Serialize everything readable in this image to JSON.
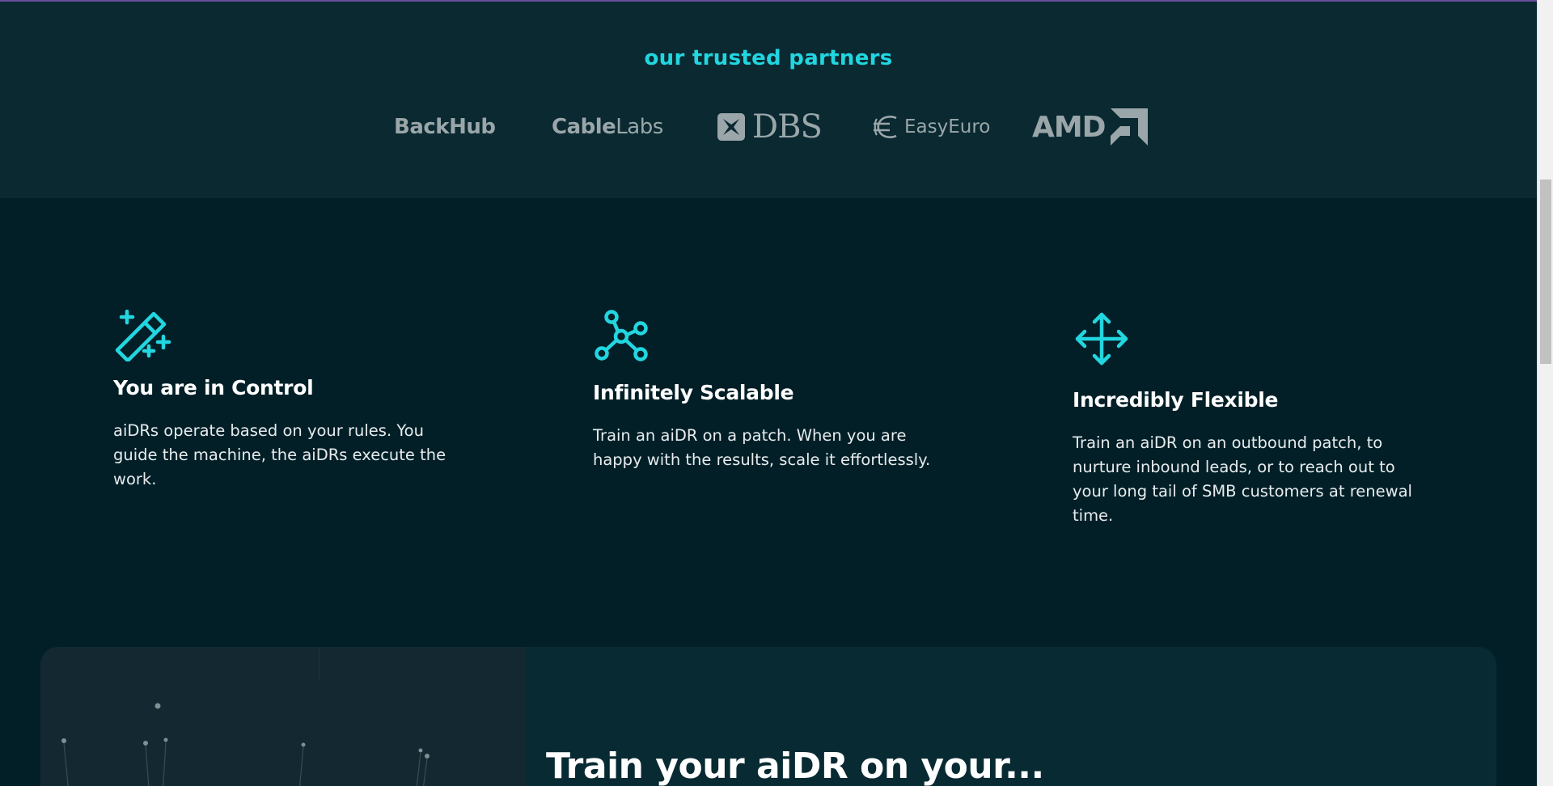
{
  "partners": {
    "title": "our trusted partners",
    "logos": [
      {
        "name": "BackHub",
        "text": "BackHub"
      },
      {
        "name": "CableLabs",
        "text_bold": "Cable",
        "text_light": "Labs"
      },
      {
        "name": "DBS",
        "text": "DBS"
      },
      {
        "name": "EasyEuro",
        "text": "EasyEuro"
      },
      {
        "name": "AMD",
        "text": "AMD"
      }
    ],
    "logo_color": "#9aa6a9"
  },
  "features": [
    {
      "icon": "magic-wand-icon",
      "title": "You are in Control",
      "description": "aiDRs operate based on your rules. You guide the machine, the aiDRs execute the work."
    },
    {
      "icon": "network-nodes-icon",
      "title": "Infinitely Scalable",
      "description": "Train an aiDR on a patch. When you are happy with the results, scale it effortlessly."
    },
    {
      "icon": "move-arrows-icon",
      "title": "Incredibly Flexible",
      "description": "Train an aiDR on an outbound patch, to nurture inbound leads, or to reach out to your long tail of SMB customers at renewal time."
    }
  ],
  "train_section": {
    "heading": "Train your aiDR on your..."
  },
  "colors": {
    "accent": "#22d6e0",
    "background": "#021f27",
    "partners_bg": "#0a2931",
    "card_bg": "#082a33"
  }
}
